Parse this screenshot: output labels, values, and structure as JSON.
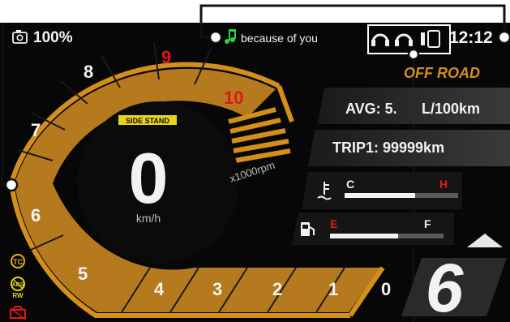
{
  "status": {
    "battery_percent": "100%",
    "song_title": "because of you",
    "time": "12:12",
    "icons": [
      "camera-battery-icon",
      "music-note-icon",
      "headset-icon",
      "headset-icon",
      "phone-icon"
    ]
  },
  "mode": "OFF ROAD",
  "gear": "6",
  "speed": {
    "value": "0",
    "unit": "km/h"
  },
  "side_stand": "SIDE STAND",
  "tachometer": {
    "unit_label": "x1000rpm",
    "ticks": [
      "0",
      "1",
      "2",
      "3",
      "4",
      "5",
      "6",
      "7",
      "8",
      "9",
      "10"
    ],
    "redline_ticks": [
      "9",
      "10"
    ],
    "rpm": 0
  },
  "info": {
    "avg_label": "AVG: 5.",
    "avg_unit": "L/100km",
    "trip_label": "TRIP1: 99999km"
  },
  "gauges": {
    "temp": {
      "low": "C",
      "high": "H",
      "level": 0.62
    },
    "fuel": {
      "low": "E",
      "high": "F",
      "level": 0.6
    }
  },
  "indicators": [
    "TC",
    "ABS RW",
    "engine"
  ],
  "colors": {
    "accent": "#d48f1a",
    "tach_fill": "#b57a1e",
    "redline": "#e01818",
    "background": "#070707",
    "song_icon": "#2bd34a"
  }
}
